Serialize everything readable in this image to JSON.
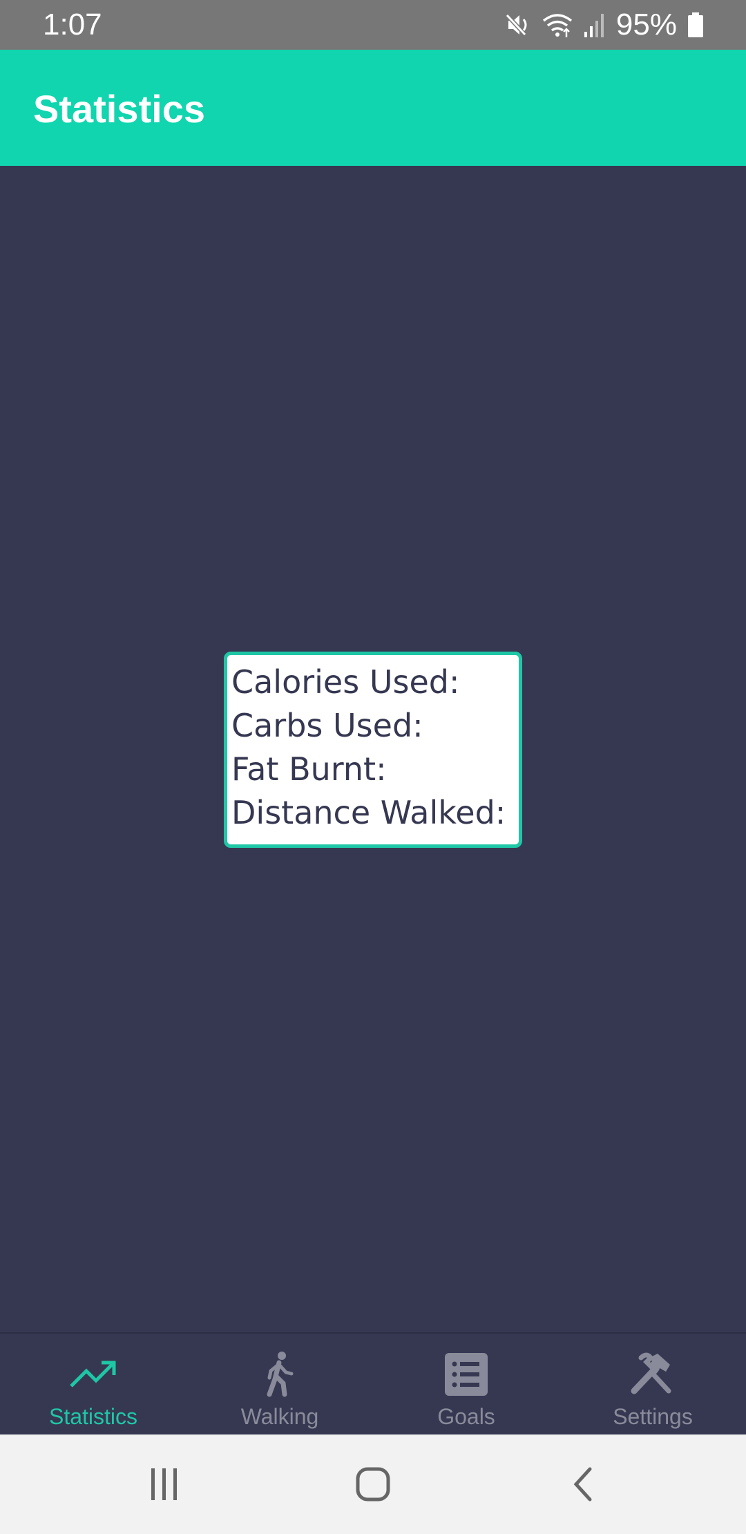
{
  "status_bar": {
    "time": "1:07",
    "battery": "95%",
    "icons": [
      "mute-icon",
      "wifi-icon",
      "signal-icon",
      "battery-icon"
    ]
  },
  "app_bar": {
    "title": "Statistics"
  },
  "stats": {
    "calories_label": "Calories Used:",
    "carbs_label": "Carbs Used:",
    "fat_label": "Fat Burnt:",
    "distance_label": "Distance Walked:"
  },
  "bottom_nav": {
    "items": [
      {
        "label": "Statistics",
        "icon": "trending-up-icon",
        "active": true
      },
      {
        "label": "Walking",
        "icon": "walking-icon",
        "active": false
      },
      {
        "label": "Goals",
        "icon": "list-icon",
        "active": false
      },
      {
        "label": "Settings",
        "icon": "tools-icon",
        "active": false
      }
    ]
  },
  "system_nav": {
    "icons": [
      "recents-icon",
      "home-icon",
      "back-icon"
    ]
  },
  "colors": {
    "accent": "#10d5ae",
    "background": "#363852",
    "inactive": "#8a8b9a",
    "status_bar": "#777777"
  }
}
